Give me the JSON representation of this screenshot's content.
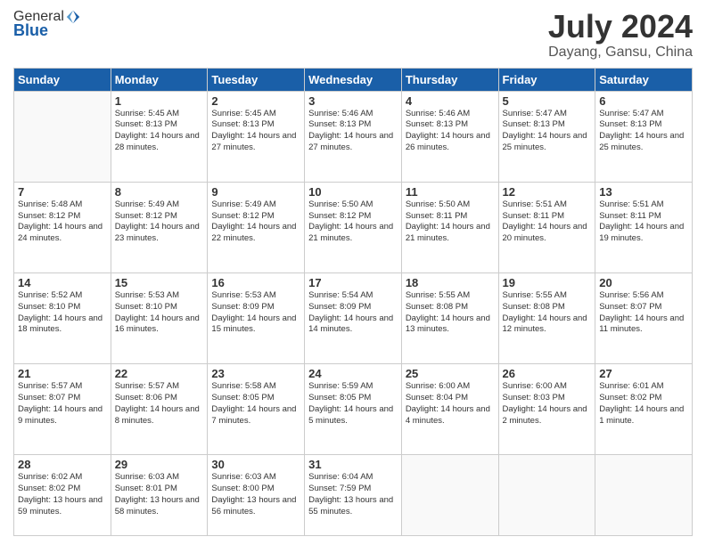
{
  "header": {
    "logo_general": "General",
    "logo_blue": "Blue",
    "month": "July 2024",
    "location": "Dayang, Gansu, China"
  },
  "weekdays": [
    "Sunday",
    "Monday",
    "Tuesday",
    "Wednesday",
    "Thursday",
    "Friday",
    "Saturday"
  ],
  "weeks": [
    [
      {
        "day": "",
        "empty": true
      },
      {
        "day": "1",
        "sunrise": "5:45 AM",
        "sunset": "8:13 PM",
        "daylight": "14 hours and 28 minutes."
      },
      {
        "day": "2",
        "sunrise": "5:45 AM",
        "sunset": "8:13 PM",
        "daylight": "14 hours and 27 minutes."
      },
      {
        "day": "3",
        "sunrise": "5:46 AM",
        "sunset": "8:13 PM",
        "daylight": "14 hours and 27 minutes."
      },
      {
        "day": "4",
        "sunrise": "5:46 AM",
        "sunset": "8:13 PM",
        "daylight": "14 hours and 26 minutes."
      },
      {
        "day": "5",
        "sunrise": "5:47 AM",
        "sunset": "8:13 PM",
        "daylight": "14 hours and 25 minutes."
      },
      {
        "day": "6",
        "sunrise": "5:47 AM",
        "sunset": "8:13 PM",
        "daylight": "14 hours and 25 minutes."
      }
    ],
    [
      {
        "day": "7",
        "sunrise": "5:48 AM",
        "sunset": "8:12 PM",
        "daylight": "14 hours and 24 minutes."
      },
      {
        "day": "8",
        "sunrise": "5:49 AM",
        "sunset": "8:12 PM",
        "daylight": "14 hours and 23 minutes."
      },
      {
        "day": "9",
        "sunrise": "5:49 AM",
        "sunset": "8:12 PM",
        "daylight": "14 hours and 22 minutes."
      },
      {
        "day": "10",
        "sunrise": "5:50 AM",
        "sunset": "8:12 PM",
        "daylight": "14 hours and 21 minutes."
      },
      {
        "day": "11",
        "sunrise": "5:50 AM",
        "sunset": "8:11 PM",
        "daylight": "14 hours and 21 minutes."
      },
      {
        "day": "12",
        "sunrise": "5:51 AM",
        "sunset": "8:11 PM",
        "daylight": "14 hours and 20 minutes."
      },
      {
        "day": "13",
        "sunrise": "5:51 AM",
        "sunset": "8:11 PM",
        "daylight": "14 hours and 19 minutes."
      }
    ],
    [
      {
        "day": "14",
        "sunrise": "5:52 AM",
        "sunset": "8:10 PM",
        "daylight": "14 hours and 18 minutes."
      },
      {
        "day": "15",
        "sunrise": "5:53 AM",
        "sunset": "8:10 PM",
        "daylight": "14 hours and 16 minutes."
      },
      {
        "day": "16",
        "sunrise": "5:53 AM",
        "sunset": "8:09 PM",
        "daylight": "14 hours and 15 minutes."
      },
      {
        "day": "17",
        "sunrise": "5:54 AM",
        "sunset": "8:09 PM",
        "daylight": "14 hours and 14 minutes."
      },
      {
        "day": "18",
        "sunrise": "5:55 AM",
        "sunset": "8:08 PM",
        "daylight": "14 hours and 13 minutes."
      },
      {
        "day": "19",
        "sunrise": "5:55 AM",
        "sunset": "8:08 PM",
        "daylight": "14 hours and 12 minutes."
      },
      {
        "day": "20",
        "sunrise": "5:56 AM",
        "sunset": "8:07 PM",
        "daylight": "14 hours and 11 minutes."
      }
    ],
    [
      {
        "day": "21",
        "sunrise": "5:57 AM",
        "sunset": "8:07 PM",
        "daylight": "14 hours and 9 minutes."
      },
      {
        "day": "22",
        "sunrise": "5:57 AM",
        "sunset": "8:06 PM",
        "daylight": "14 hours and 8 minutes."
      },
      {
        "day": "23",
        "sunrise": "5:58 AM",
        "sunset": "8:05 PM",
        "daylight": "14 hours and 7 minutes."
      },
      {
        "day": "24",
        "sunrise": "5:59 AM",
        "sunset": "8:05 PM",
        "daylight": "14 hours and 5 minutes."
      },
      {
        "day": "25",
        "sunrise": "6:00 AM",
        "sunset": "8:04 PM",
        "daylight": "14 hours and 4 minutes."
      },
      {
        "day": "26",
        "sunrise": "6:00 AM",
        "sunset": "8:03 PM",
        "daylight": "14 hours and 2 minutes."
      },
      {
        "day": "27",
        "sunrise": "6:01 AM",
        "sunset": "8:02 PM",
        "daylight": "14 hours and 1 minute."
      }
    ],
    [
      {
        "day": "28",
        "sunrise": "6:02 AM",
        "sunset": "8:02 PM",
        "daylight": "13 hours and 59 minutes."
      },
      {
        "day": "29",
        "sunrise": "6:03 AM",
        "sunset": "8:01 PM",
        "daylight": "13 hours and 58 minutes."
      },
      {
        "day": "30",
        "sunrise": "6:03 AM",
        "sunset": "8:00 PM",
        "daylight": "13 hours and 56 minutes."
      },
      {
        "day": "31",
        "sunrise": "6:04 AM",
        "sunset": "7:59 PM",
        "daylight": "13 hours and 55 minutes."
      },
      {
        "day": "",
        "empty": true
      },
      {
        "day": "",
        "empty": true
      },
      {
        "day": "",
        "empty": true
      }
    ]
  ]
}
